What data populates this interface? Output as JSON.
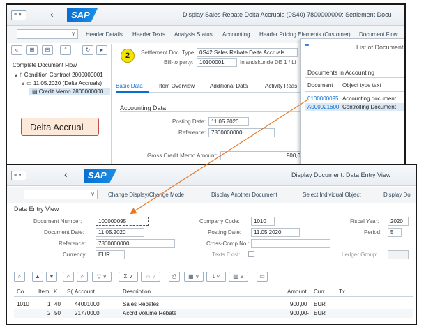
{
  "back_window": {
    "logo": "SAP",
    "title": "Display Sales Rebate Delta Accruals (0S40) 7800000000: Settlement Docu",
    "toolbar": [
      "Header Details",
      "Header Texts",
      "Analysis Status",
      "Accounting",
      "Header Pricing Elements (Customer)",
      "Document Flow"
    ],
    "step_badge": "2",
    "settlement_doc_label": "Settlement Doc. Type:",
    "settlement_doc_value": "0S42 Sales Rebate Delta Accruals",
    "bill_to_label": "Bill-to party:",
    "bill_to_value": "10100001",
    "bill_to_name": "Inlandskunde DE 1 / Li",
    "doc_flow": {
      "title": "Complete Document Flow",
      "items": [
        "Condition Contract 2000000001",
        "11.05.2020 (Delta Accruals)",
        "Credit Memo 7800000000"
      ]
    },
    "tabs": [
      "Basic Data",
      "Item Overview",
      "Additional Data",
      "Activity Reas"
    ],
    "section": "Accounting Data",
    "posting_date_label": "Posting Date:",
    "posting_date_value": "11.05.2020",
    "reference_label": "Reference:",
    "reference_value": "7800000000",
    "gross_label": "Gross Credit Memo Amount:",
    "gross_value": "900,0",
    "callout": "Delta Accrual",
    "popup": {
      "title": "List of Documents",
      "subtitle": "Documents in Accounting",
      "col_document": "Document",
      "col_type": "Object type text",
      "rows": [
        {
          "document": "0100000095",
          "type": "Accounting document"
        },
        {
          "document": "A000021600",
          "type": "Controlling Document"
        }
      ]
    }
  },
  "front_window": {
    "logo": "SAP",
    "title": "Display Document: Data Entry View",
    "toolbar": [
      "Change Display/Change Mode",
      "Display Another Document",
      "Select Individual Object",
      "Display Do"
    ],
    "section": "Data Entry View",
    "fields": {
      "doc_number_label": "Document Number:",
      "doc_number_value": "100000095",
      "company_code_label": "Company Code:",
      "company_code_value": "1010",
      "fiscal_year_label": "Fiscal Year:",
      "fiscal_year_value": "2020",
      "doc_date_label": "Document Date:",
      "doc_date_value": "11.05.2020",
      "posting_date_label": "Posting Date:",
      "posting_date_value": "11.05.2020",
      "period_label": "Period:",
      "period_value": "5",
      "reference_label": "Reference:",
      "reference_value": "7800000000",
      "cross_comp_label": "Cross-Comp.No.:",
      "currency_label": "Currency:",
      "currency_value": "EUR",
      "texts_exist_label": "Texts Exist:",
      "ledger_group_label": "Ledger Group:"
    },
    "table": {
      "headers": [
        "Co...",
        "Item",
        "K..",
        "S(",
        "Account",
        "Description",
        "Amount",
        "Curr.",
        "Tx"
      ],
      "rows": [
        {
          "co": "1010",
          "item": "1",
          "k": "40",
          "account": "44001000",
          "description": "Sales Rebates",
          "amount": "900,00",
          "curr": "EUR"
        },
        {
          "co": "",
          "item": "2",
          "k": "50",
          "account": "21770000",
          "description": "Accrd Volume Rebate",
          "amount": "900,00-",
          "curr": "EUR"
        }
      ]
    }
  },
  "colors": {
    "accent": "#0a6ed1",
    "callout_bg": "#fde9d9",
    "arrow": "#e87722",
    "badge": "#f5e400"
  }
}
